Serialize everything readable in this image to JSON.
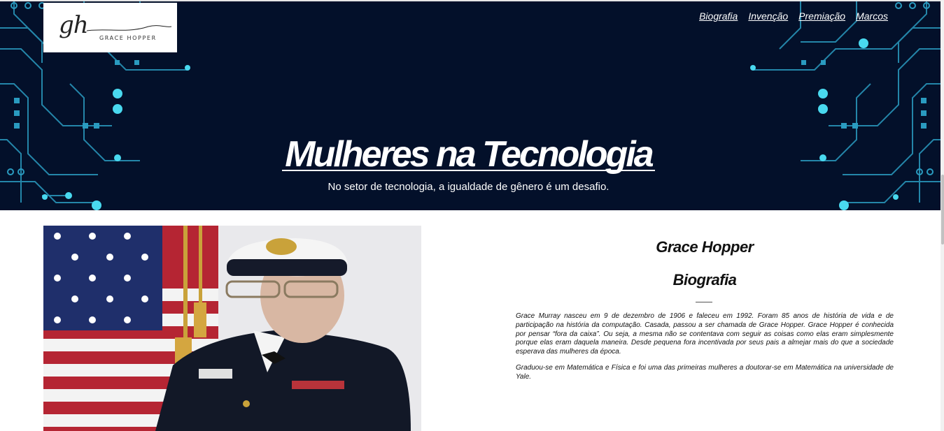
{
  "header": {
    "logo": {
      "mark": "gh",
      "name": "GRACE HOPPER"
    },
    "nav": [
      {
        "label": "Biografia"
      },
      {
        "label": "Invenção"
      },
      {
        "label": "Premiação"
      },
      {
        "label": "Marcos"
      }
    ]
  },
  "hero": {
    "title": "Mulheres na Tecnologia",
    "subtitle": "No setor de tecnologia, a igualdade de gênero é um desafio."
  },
  "bio": {
    "name": "Grace Hopper",
    "heading": "Biografia",
    "paragraphs": [
      "Grace Murray nasceu em 9 de dezembro de 1906 e faleceu em 1992. Foram 85 anos de história de vida e de participação na história da computação. Casada, passou a ser chamada de Grace Hopper. Grace Hopper é conhecida por pensar “fora da caixa”. Ou seja, a mesma não se contentava com seguir as coisas como elas eram simplesmente porque elas eram daquela maneira. Desde pequena fora incentivada por seus pais a almejar mais do que a sociedade esperava das mulheres da época.",
      "Graduou-se em Matemática e Física e foi uma das primeiras mulheres a doutorar-se em Matemática na universidade de Yale."
    ]
  },
  "colors": {
    "hero_bg": "#03102a",
    "circuit": "#2aa8c8",
    "circuit_node": "#49d9ef"
  }
}
